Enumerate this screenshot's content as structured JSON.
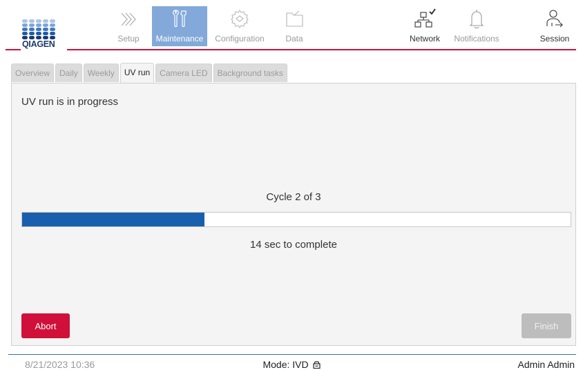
{
  "brand": {
    "logo_text": "QIAGEN",
    "logo_dot_colors": [
      "#aac4e6",
      "#7ea6d8",
      "#3f78c0",
      "#1f5da8",
      "#1b3a6b"
    ]
  },
  "colors": {
    "accent_red": "#d0103a",
    "active_nav": "#82a9d9",
    "progress_fill": "#1a5fad",
    "disabled_button": "#bdbdbd"
  },
  "nav": {
    "setup": {
      "label": "Setup",
      "icon": "chevron-double-right-icon"
    },
    "maintenance": {
      "label": "Maintenance",
      "icon": "tools-icon"
    },
    "configuration": {
      "label": "Configuration",
      "icon": "gear-icon"
    },
    "data": {
      "label": "Data",
      "icon": "folder-icon"
    },
    "network": {
      "label": "Network",
      "icon": "network-connected-icon"
    },
    "notifications": {
      "label": "Notifications",
      "icon": "bell-icon"
    },
    "session": {
      "label": "Session",
      "icon": "user-logout-icon"
    }
  },
  "tabs": [
    {
      "label": "Overview"
    },
    {
      "label": "Daily"
    },
    {
      "label": "Weekly"
    },
    {
      "label": "UV run"
    },
    {
      "label": "Camera LED"
    },
    {
      "label": "Background tasks"
    }
  ],
  "active_tab": "UV run",
  "panel": {
    "status": "UV run is in progress",
    "cycle": "Cycle 2 of 3",
    "progress_fraction": 0.333,
    "remaining": "14 sec to complete",
    "abort_label": "Abort",
    "finish_label": "Finish"
  },
  "footer": {
    "datetime": "8/21/2023 10:36",
    "mode": "Mode: IVD",
    "mode_icon": "lock-icon",
    "user": "Admin Admin"
  }
}
